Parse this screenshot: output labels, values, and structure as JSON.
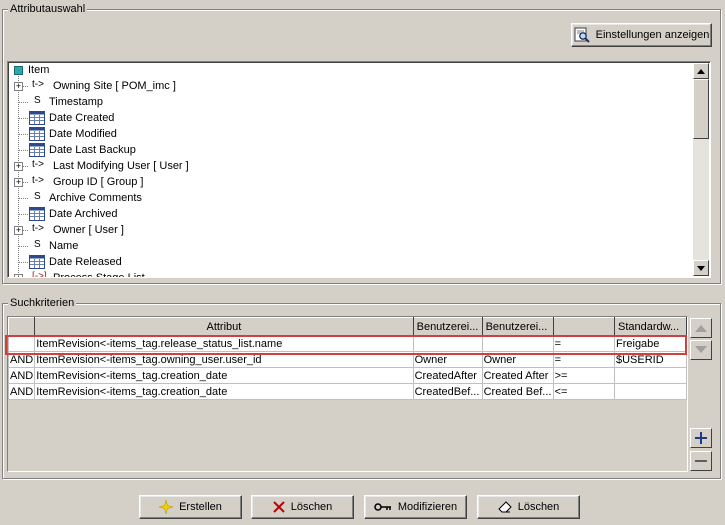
{
  "attribute_section": {
    "title": "Attributauswahl",
    "settings_button": "Einstellungen anzeigen"
  },
  "tree": {
    "root_label": "Item",
    "items": [
      {
        "prefix": "t->",
        "label": "Owning Site [ POM_imc ]",
        "icon": "reference-icon",
        "expandable": true
      },
      {
        "prefix": "S",
        "label": "Timestamp",
        "icon": "string-icon",
        "expandable": false
      },
      {
        "prefix": "",
        "label": "Date Created",
        "icon": "date-icon",
        "expandable": false
      },
      {
        "prefix": "",
        "label": "Date Modified",
        "icon": "date-icon",
        "expandable": false
      },
      {
        "prefix": "",
        "label": "Date Last Backup",
        "icon": "date-icon",
        "expandable": false
      },
      {
        "prefix": "t->",
        "label": "Last Modifying User [ User ]",
        "icon": "reference-icon",
        "expandable": true
      },
      {
        "prefix": "t->",
        "label": "Group ID [ Group ]",
        "icon": "reference-icon",
        "expandable": true
      },
      {
        "prefix": "S",
        "label": "Archive Comments",
        "icon": "string-icon",
        "expandable": false
      },
      {
        "prefix": "",
        "label": "Date Archived",
        "icon": "date-icon",
        "expandable": false
      },
      {
        "prefix": "t->",
        "label": "Owner [ User ]",
        "icon": "reference-icon",
        "expandable": true
      },
      {
        "prefix": "S",
        "label": "Name",
        "icon": "string-icon",
        "expandable": false
      },
      {
        "prefix": "",
        "label": "Date Released",
        "icon": "date-icon",
        "expandable": false
      },
      {
        "prefix": "[->]",
        "label": "Process Stage List",
        "icon": "list-reference-icon",
        "expandable": true
      }
    ]
  },
  "search_section": {
    "title": "Suchkriterien",
    "columns": [
      "",
      "Attribut",
      "Benutzerei...",
      "Benutzerei...",
      "",
      "Standardw..."
    ],
    "rows": [
      [
        "",
        "ItemRevision<-items_tag.release_status_list.name",
        "",
        "",
        "=",
        "Freigabe"
      ],
      [
        "AND",
        "ItemRevision<-items_tag.owning_user.user_id",
        "Owner",
        "Owner",
        "=",
        "$USERID"
      ],
      [
        "AND",
        "ItemRevision<-items_tag.creation_date",
        "CreatedAfter",
        "Created After",
        ">=",
        ""
      ],
      [
        "AND",
        "ItemRevision<-items_tag.creation_date",
        "CreatedBef...",
        "Created Bef...",
        "<=",
        ""
      ]
    ]
  },
  "footer": {
    "create": "Erstellen",
    "delete1": "Löschen",
    "modify": "Modifizieren",
    "delete2": "Löschen"
  },
  "colors": {
    "window_bg": "#d4d0c8",
    "selection_border": "#d04040",
    "date_icon": "#2c4a8c",
    "root_icon": "#2aa8b0"
  }
}
